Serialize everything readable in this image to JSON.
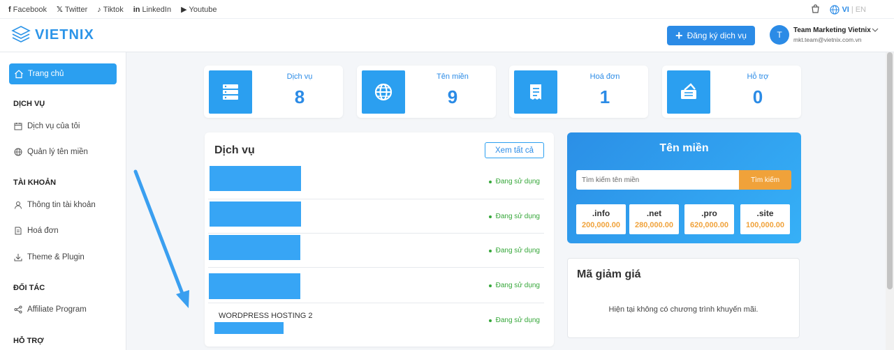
{
  "social": [
    {
      "icon": "facebook-icon",
      "glyph": "f",
      "label": "Facebook"
    },
    {
      "icon": "twitter-icon",
      "glyph": "𝕏",
      "label": "Twitter"
    },
    {
      "icon": "tiktok-icon",
      "glyph": "♪",
      "label": "Tiktok"
    },
    {
      "icon": "linkedin-icon",
      "glyph": "in",
      "label": "LinkedIn"
    },
    {
      "icon": "youtube-icon",
      "glyph": "▶",
      "label": "Youtube"
    }
  ],
  "lang": {
    "vi": "VI",
    "sep": "|",
    "en": "EN"
  },
  "logo": {
    "text": "VIETNIX"
  },
  "header": {
    "register_label": "Đăng ký dịch vụ"
  },
  "user": {
    "initial": "T",
    "name": "Team Marketing Vietnix",
    "email": "mkt.team@vietnix.com.vn"
  },
  "sidebar": {
    "home": "Trang chủ",
    "sections": [
      "DỊCH VỤ",
      "TÀI KHOẢN",
      "ĐỐI TÁC",
      "HỖ TRỢ"
    ],
    "items": [
      {
        "label": "Dịch vụ của tôi",
        "icon": "calendar-icon"
      },
      {
        "label": "Quản lý tên miền",
        "icon": "globe-icon"
      },
      {
        "label": "Thông tin tài khoản",
        "icon": "user-icon"
      },
      {
        "label": "Hoá đơn",
        "icon": "invoice-icon"
      },
      {
        "label": "Theme & Plugin",
        "icon": "download-icon"
      },
      {
        "label": "Affiliate Program",
        "icon": "share-icon"
      }
    ]
  },
  "stats": [
    {
      "label": "Dịch vụ",
      "value": "8",
      "icon": "server-icon"
    },
    {
      "label": "Tên miền",
      "value": "9",
      "icon": "globe-icon"
    },
    {
      "label": "Hoá đơn",
      "value": "1",
      "icon": "receipt-icon"
    },
    {
      "label": "Hỗ trợ",
      "value": "0",
      "icon": "ticket-icon"
    }
  ],
  "services": {
    "title": "Dịch vụ",
    "view_all": "Xem tất cả",
    "rows": [
      {
        "name": "",
        "status": "Đang sử dụng"
      },
      {
        "name": "",
        "status": "Đang sử dụng"
      },
      {
        "name": "",
        "status": "Đang sử dụng"
      },
      {
        "name": "",
        "status": "Đang sử dụng"
      },
      {
        "name": "WORDPRESS HOSTING 2",
        "status": "Đang sử dụng"
      }
    ]
  },
  "domain": {
    "title": "Tên miền",
    "placeholder": "Tìm kiếm tên miền",
    "search": "Tìm kiếm",
    "tlds": [
      {
        "ext": ".info",
        "price": "200,000.00"
      },
      {
        "ext": ".net",
        "price": "280,000.00"
      },
      {
        "ext": ".pro",
        "price": "620,000.00"
      },
      {
        "ext": ".site",
        "price": "100,000.00"
      }
    ]
  },
  "coupon": {
    "title": "Mã giảm giá",
    "message": "Hiện tại không có chương trình khuyến mãi."
  },
  "colors": {
    "accent": "#2b8be6",
    "orange": "#f0a23a",
    "green": "#36a73a"
  }
}
